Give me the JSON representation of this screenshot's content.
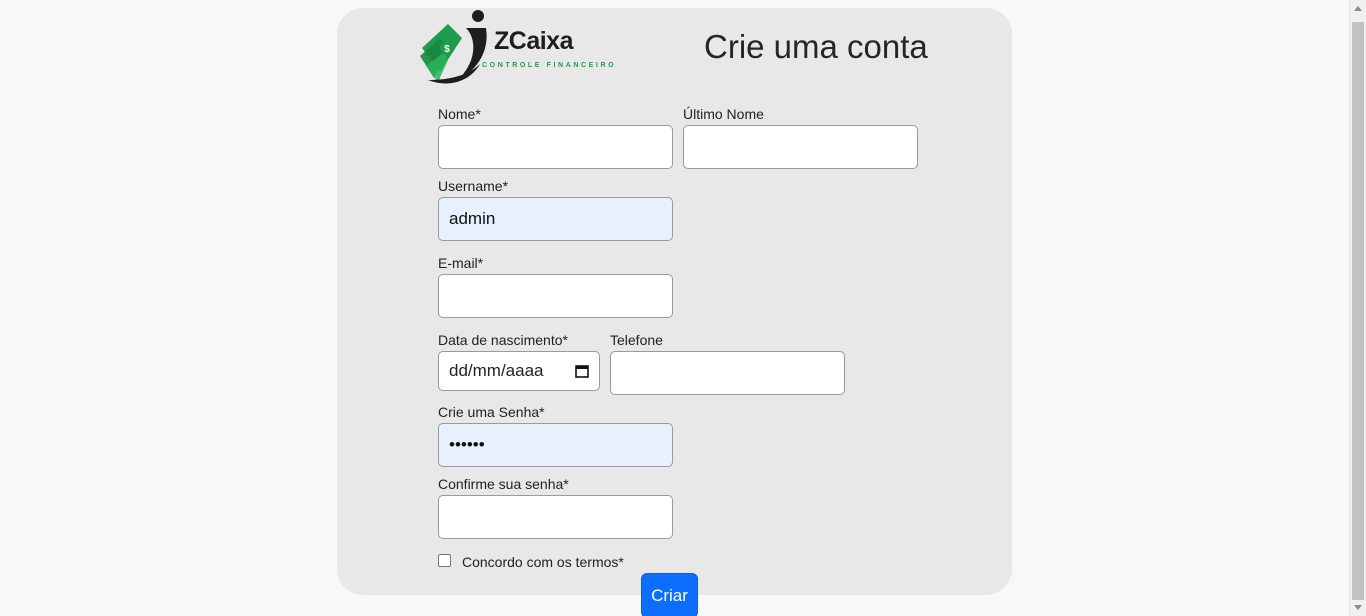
{
  "brand": {
    "name": "ZCaixa",
    "tagline": "CONTROLE FINANCEIRO",
    "colors": {
      "green": "#1f9d4b",
      "dark": "#1e1e1e"
    }
  },
  "page_title": "Crie uma conta",
  "form": {
    "first_name": {
      "label": "Nome*",
      "value": ""
    },
    "last_name": {
      "label": "Último Nome",
      "value": ""
    },
    "username": {
      "label": "Username*",
      "value": "admin"
    },
    "email": {
      "label": "E-mail*",
      "value": ""
    },
    "birth_date": {
      "label": "Data de nascimento*",
      "placeholder": "dd/mm/aaaa"
    },
    "phone": {
      "label": "Telefone",
      "value": ""
    },
    "password": {
      "label": "Crie uma Senha*",
      "value": "••••••"
    },
    "confirm_password": {
      "label": "Confirme sua senha*",
      "value": ""
    },
    "terms": {
      "label": "Concordo com os termos*",
      "checked": false
    },
    "submit_label": "Criar"
  },
  "colors": {
    "button": "#0d6efd",
    "autofill": "#e8f0fe",
    "card": "#e8e8e8"
  }
}
